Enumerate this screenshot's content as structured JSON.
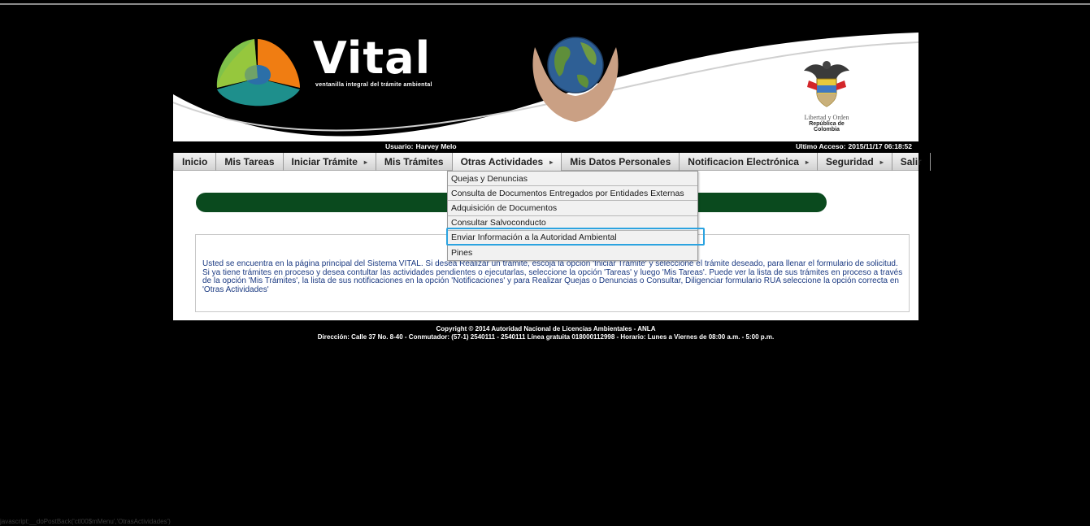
{
  "banner": {
    "brand_name": "Vital",
    "tagline": "ventanilla integral del trámite ambiental",
    "coat_motto": "Libertad y Orden",
    "country": "República de Colombia"
  },
  "userbar": {
    "user_label": "Usuario:",
    "user_name": "Harvey Melo",
    "access_label": "Ultimo Acceso:",
    "access_value": "2015/11/17 06:18:52"
  },
  "menu": {
    "items": [
      {
        "label": "Inicio"
      },
      {
        "label": "Mis Tareas"
      },
      {
        "label": "Iniciar Trámite",
        "arrow": "▸"
      },
      {
        "label": "Mis Trámites"
      },
      {
        "label": "Otras Actividades",
        "arrow": "▸"
      },
      {
        "label": "Mis Datos Personales"
      },
      {
        "label": "Notificacion Electrónica",
        "arrow": "▸"
      },
      {
        "label": "Seguridad",
        "arrow": "▸"
      },
      {
        "label": "Salir"
      }
    ]
  },
  "dropdown": {
    "items": [
      {
        "label": "Quejas y Denuncias"
      },
      {
        "label": "Consulta de Documentos Entregados por Entidades Externas"
      },
      {
        "label": "Adquisición de Documentos"
      },
      {
        "label": "Consultar Salvoconducto"
      },
      {
        "label": "Enviar Información a la Autoridad Ambiental"
      },
      {
        "label": "Pines"
      }
    ],
    "highlight_color": "#2ba3e0"
  },
  "main": {
    "info_text": "Usted se encuentra en la página principal del Sistema VITAL. Si desea Realizar un trámite, escoja la opción 'Iniciar Trámite' y seleccione el trámite deseado, para llenar el formulario de solicitud. Si ya tiene trámites en proceso y desea contultar las actividades pendientes o ejecutarlas, seleccione la opción 'Tareas' y luego 'Mis Tareas'. Puede ver la lista de sus trámites en proceso a través de la opción 'Mis Trámites', la lista de sus notificaciones en la opción 'Notificaciones' y para Realizar Quejas o Denuncias o Consultar, Diligenciar formulario RUA seleccione la opción correcta en 'Otras Actividades'",
    "green_bar_color": "#0a4a1e"
  },
  "footer": {
    "copyright": "Copyright © 2014 Autoridad Nacional de Licencias Ambientales - ANLA",
    "address": "Dirección: Calle 37 No. 8-40 - Conmutador: (57-1) 2540111 - 2540111 Línea gratuita 018000112998 - Horario: Lunes a Viernes de 08:00 a.m. - 5:00 p.m."
  },
  "status_bar": {
    "text": "javascript:__doPostBack('ctl00$mMenu','OtrasActividades')"
  }
}
